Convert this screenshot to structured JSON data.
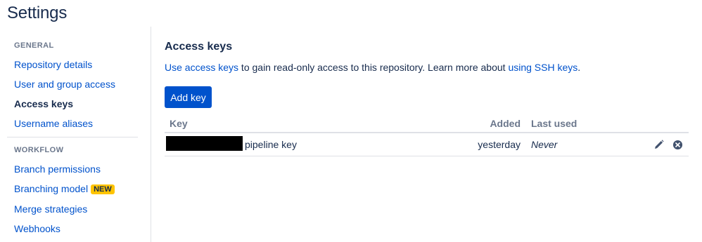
{
  "page": {
    "title": "Settings"
  },
  "sidebar": {
    "general_heading": "GENERAL",
    "general_items": [
      {
        "label": "Repository details"
      },
      {
        "label": "User and group access"
      },
      {
        "label": "Access keys"
      },
      {
        "label": "Username aliases"
      }
    ],
    "workflow_heading": "WORKFLOW",
    "workflow_items": [
      {
        "label": "Branch permissions"
      },
      {
        "label": "Branching model",
        "badge": "NEW"
      },
      {
        "label": "Merge strategies"
      },
      {
        "label": "Webhooks"
      }
    ]
  },
  "main": {
    "heading": "Access keys",
    "description": {
      "link1": "Use access keys",
      "text1": " to gain read-only access to this repository. Learn more about ",
      "link2": "using SSH keys",
      "text2": "."
    },
    "add_button": "Add key",
    "table": {
      "headers": {
        "key": "Key",
        "added": "Added",
        "last_used": "Last used"
      },
      "rows": [
        {
          "key_label": "pipeline key",
          "added": "yesterday",
          "last_used": "Never"
        }
      ]
    }
  },
  "icons": {
    "edit": "pencil-icon",
    "delete": "close-circle-icon"
  },
  "colors": {
    "link": "#0052cc",
    "primary_button": "#0052cc",
    "badge": "#ffc400",
    "text": "#172b4d",
    "muted": "#6b778c"
  }
}
